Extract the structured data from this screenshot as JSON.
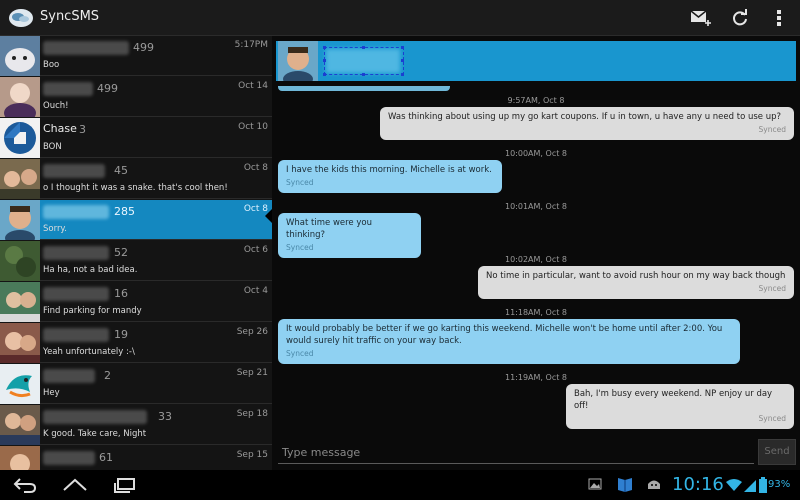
{
  "app": {
    "title": "SyncSMS"
  },
  "colors": {
    "accent": "#1488c0",
    "header": "#1996cf",
    "incoming": "#8fd1f2",
    "outgoing": "#dcdcdc",
    "clock": "#33b5e5"
  },
  "actionbar": {
    "icons": [
      "new-message-icon",
      "refresh-icon",
      "overflow-menu-icon"
    ]
  },
  "conversations": [
    {
      "name": "",
      "count": "499",
      "date": "5:17PM",
      "snippet": "Boo"
    },
    {
      "name": "",
      "count": "499",
      "date": "Oct 14",
      "snippet": "Ouch!"
    },
    {
      "name": "Chase",
      "count": "3",
      "date": "Oct 10",
      "snippet": "BON"
    },
    {
      "name": "",
      "count": "45",
      "date": "Oct 8",
      "snippet": "o I thought it was a snake. that's cool then!"
    },
    {
      "name": "",
      "count": "285",
      "date": "Oct 8",
      "snippet": "Sorry."
    },
    {
      "name": "",
      "count": "52",
      "date": "Oct 6",
      "snippet": "Ha ha, not a bad idea."
    },
    {
      "name": "",
      "count": "16",
      "date": "Oct 4",
      "snippet": "Find parking for mandy"
    },
    {
      "name": "",
      "count": "19",
      "date": "Sep 26",
      "snippet": "Yeah unfortunately :-\\"
    },
    {
      "name": "",
      "count": "2",
      "date": "Sep 21",
      "snippet": "Hey"
    },
    {
      "name": "",
      "count": "33",
      "date": "Sep 18",
      "snippet": "K good. Take care, Night"
    },
    {
      "name": "",
      "count": "61",
      "date": "Sep 15",
      "snippet": ""
    }
  ],
  "thread": {
    "messages": [
      {
        "time": "9:57AM, Oct 8",
        "dir": "out",
        "text": "Was thinking about using up my go kart coupons. If u in town, u have any u need to use up?",
        "status": "Synced"
      },
      {
        "time": "10:00AM, Oct 8",
        "dir": "in",
        "text": "I have the kids this morning. Michelle is at work.",
        "status": "Synced"
      },
      {
        "time": "10:01AM, Oct 8",
        "dir": "in",
        "text": "What time were you thinking?",
        "status": "Synced"
      },
      {
        "time": "10:02AM, Oct 8",
        "dir": "out",
        "text": "No time in particular, want to avoid rush hour on my way back though",
        "status": "Synced"
      },
      {
        "time": "11:18AM, Oct 8",
        "dir": "in",
        "text": "It would probably be better if we go karting this weekend. Michelle won't be home until after 2:00. You would surely hit traffic on your way back.",
        "status": "Synced"
      },
      {
        "time": "11:19AM, Oct 8",
        "dir": "out",
        "text": "Bah, I'm busy every weekend. NP enjoy ur day off!",
        "status": "Synced"
      }
    ]
  },
  "compose": {
    "placeholder": "Type message",
    "send_label": "Send"
  },
  "statusbar": {
    "time": "10:16",
    "battery": "93%"
  }
}
